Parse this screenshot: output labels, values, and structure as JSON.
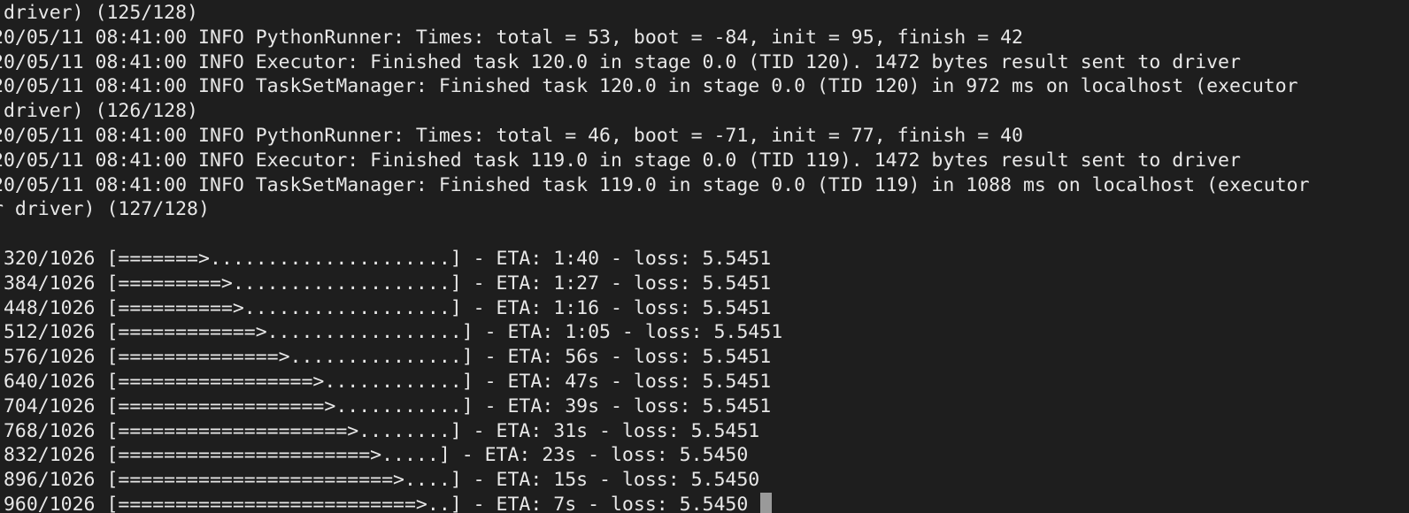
{
  "terminal": {
    "lines": [
      " driver) (125/128)",
      "20/05/11 08:41:00 INFO PythonRunner: Times: total = 53, boot = -84, init = 95, finish = 42",
      "20/05/11 08:41:00 INFO Executor: Finished task 120.0 in stage 0.0 (TID 120). 1472 bytes result sent to driver",
      "20/05/11 08:41:00 INFO TaskSetManager: Finished task 120.0 in stage 0.0 (TID 120) in 972 ms on localhost (executor",
      " driver) (126/128)",
      "20/05/11 08:41:00 INFO PythonRunner: Times: total = 46, boot = -71, init = 77, finish = 40",
      "20/05/11 08:41:00 INFO Executor: Finished task 119.0 in stage 0.0 (TID 119). 1472 bytes result sent to driver",
      "20/05/11 08:41:00 INFO TaskSetManager: Finished task 119.0 in stage 0.0 (TID 119) in 1088 ms on localhost (executor",
      "r driver) (127/128)",
      "",
      " 320/1026 [=======>.....................] - ETA: 1:40 - loss: 5.5451",
      " 384/1026 [=========>...................] - ETA: 1:27 - loss: 5.5451",
      " 448/1026 [==========>..................] - ETA: 1:16 - loss: 5.5451",
      " 512/1026 [============>.................] - ETA: 1:05 - loss: 5.5451",
      " 576/1026 [==============>...............] - ETA: 56s - loss: 5.5451",
      " 640/1026 [=================>............] - ETA: 47s - loss: 5.5451",
      " 704/1026 [==================>...........] - ETA: 39s - loss: 5.5451",
      " 768/1026 [====================>........] - ETA: 31s - loss: 5.5451",
      " 832/1026 [======================>.....] - ETA: 23s - loss: 5.5450",
      " 896/1026 [========================>....] - ETA: 15s - loss: 5.5450",
      " 960/1026 [==========================>..] - ETA: 7s - loss: 5.5450"
    ]
  }
}
